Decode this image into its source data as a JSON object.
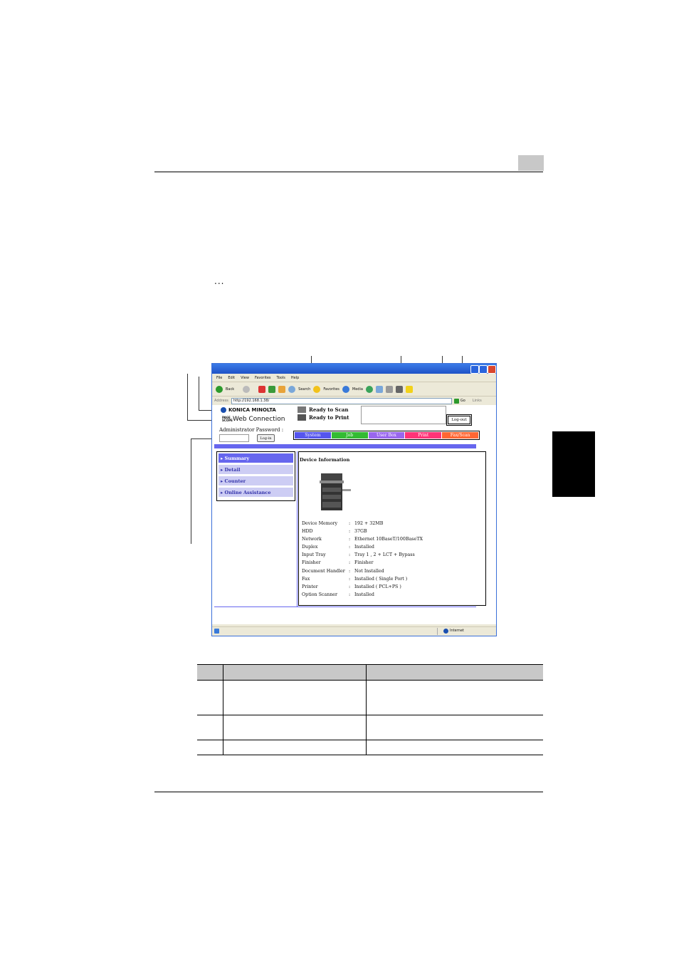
{
  "browser": {
    "menu": [
      "File",
      "Edit",
      "View",
      "Favorites",
      "Tools",
      "Help"
    ],
    "toolbar": {
      "back": "Back",
      "search": "Search",
      "favorites": "Favorites",
      "media": "Media"
    },
    "address_label": "Address",
    "address_value": "http://192.168.1.38/",
    "go": "Go",
    "links": "Links",
    "status_zone": "Internet"
  },
  "web": {
    "brand": "KONICA MINOLTA",
    "product_mark": "PAGE SCOPE",
    "product": "Web Connection",
    "status_scan": "Ready to Scan",
    "status_print": "Ready to Print",
    "logout": "Log-out",
    "admin_label": "Administrator Password :",
    "login": "Log-in",
    "tabs": [
      {
        "label": "System",
        "color": "#5555ee"
      },
      {
        "label": "Job",
        "color": "#33bb33"
      },
      {
        "label": "User Box",
        "color": "#9966ee"
      },
      {
        "label": "Print",
        "color": "#ff3377"
      },
      {
        "label": "Fax/Scan",
        "color": "#ff6633"
      }
    ],
    "nav": [
      "Summary",
      "Detail",
      "Counter",
      "Online Assistance"
    ],
    "device_title": "Device Information",
    "specs": [
      {
        "k": "Device Memory",
        "v": "192 + 32MB"
      },
      {
        "k": "HDD",
        "v": "37GB"
      },
      {
        "k": "Network",
        "v": "Ethernet 10BaseT/100BaseTX"
      },
      {
        "k": "Duplex",
        "v": "Installed"
      },
      {
        "k": "Input Tray",
        "v": "Tray 1 , 2 + LCT + Bypass"
      },
      {
        "k": "Finisher",
        "v": "Finisher"
      },
      {
        "k": "Document Handler",
        "v": "Not Installed"
      },
      {
        "k": "Fax",
        "v": "Installed ( Single Port )"
      },
      {
        "k": "Printer",
        "v": "Installed ( PCL+PS )"
      },
      {
        "k": "Option Scanner",
        "v": "Installed"
      }
    ]
  },
  "page": {
    "ellipsis": "..."
  }
}
